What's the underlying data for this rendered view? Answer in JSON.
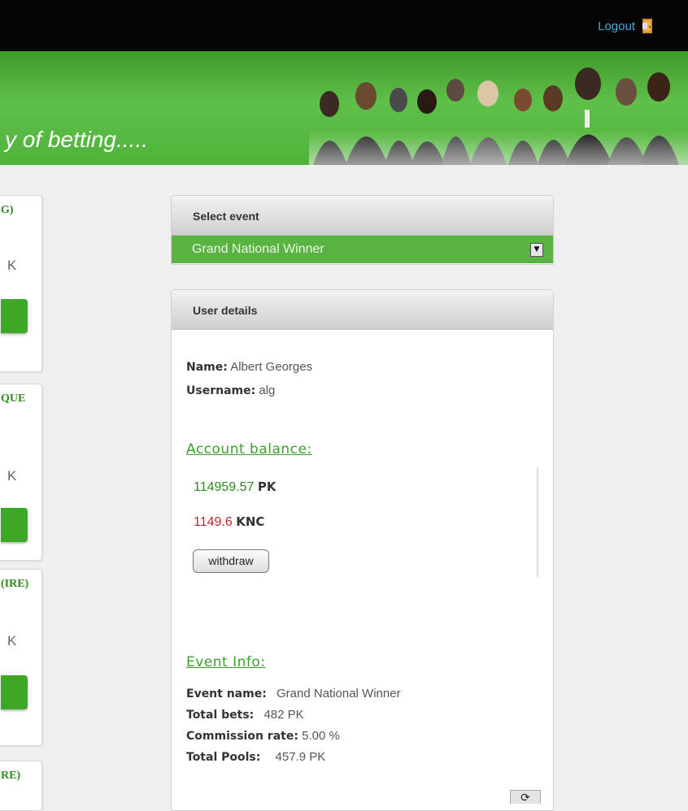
{
  "header": {
    "logout_label": "Logout"
  },
  "banner": {
    "tagline": "y of betting....."
  },
  "left_cards": [
    {
      "title": "G)",
      "unit": "K"
    },
    {
      "title": "QUE",
      "unit": "K"
    },
    {
      "title": "(IRE)",
      "unit": "K"
    },
    {
      "title": "RE)"
    }
  ],
  "select_event": {
    "heading": "Select event",
    "selected": "Grand National Winner"
  },
  "user_details": {
    "heading": "User details",
    "name_label": "Name:",
    "name_value": "Albert Georges",
    "username_label": "Username:",
    "username_value": "alg",
    "balance_heading": "Account balance:",
    "balances": [
      {
        "amount": "114959.57",
        "unit": "PK",
        "color": "#2e8b1f"
      },
      {
        "amount": "1149.6",
        "unit": "KNC",
        "color": "#c0282d"
      }
    ],
    "withdraw_label": "withdraw"
  },
  "event_info": {
    "heading": "Event Info:",
    "rows": [
      {
        "label": "Event name:",
        "value": "Grand National Winner"
      },
      {
        "label": "Total bets:",
        "value": "482 PK"
      },
      {
        "label": "Commission rate:",
        "value": "5.00 %"
      },
      {
        "label": "Total Pools:",
        "value": "457.9 PK"
      }
    ]
  },
  "colors": {
    "accent_green": "#58b342",
    "banner_green": "#4fb33a",
    "link_blue": "#4aa8d8"
  }
}
